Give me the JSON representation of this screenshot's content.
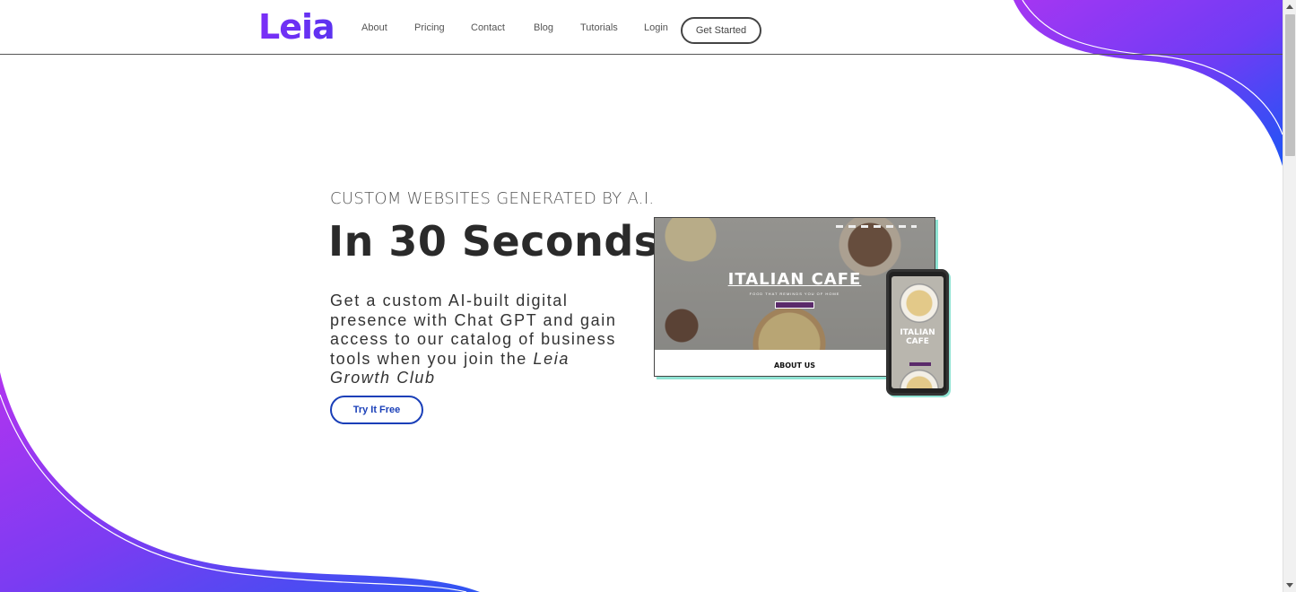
{
  "header": {
    "logo": "Leia",
    "nav": [
      "About",
      "Pricing",
      "Contact",
      "Blog",
      "Tutorials",
      "Login"
    ],
    "cta": "Get Started"
  },
  "hero": {
    "eyebrow": "CUSTOM WEBSITES GENERATED BY A.I.",
    "title": "In 30 Seconds",
    "body": "Get a custom AI-built digital presence with Chat GPT and gain access to our catalog of business tools when you join the",
    "body_emphasis": "Leia Growth Club",
    "button": "Try It Free"
  },
  "mockup": {
    "desktop_title": "ITALIAN CAFE",
    "desktop_subtitle": "FOOD THAT REMINDS YOU OF HOME",
    "desktop_section": "ABOUT US",
    "phone_title": "ITALIAN CAFE"
  },
  "colors": {
    "brand_purple": "#7b2ff7",
    "gradient_blue": "#1f4ff2",
    "button_blue": "#1a3fb8",
    "mock_accent": "#8fe3d3"
  }
}
